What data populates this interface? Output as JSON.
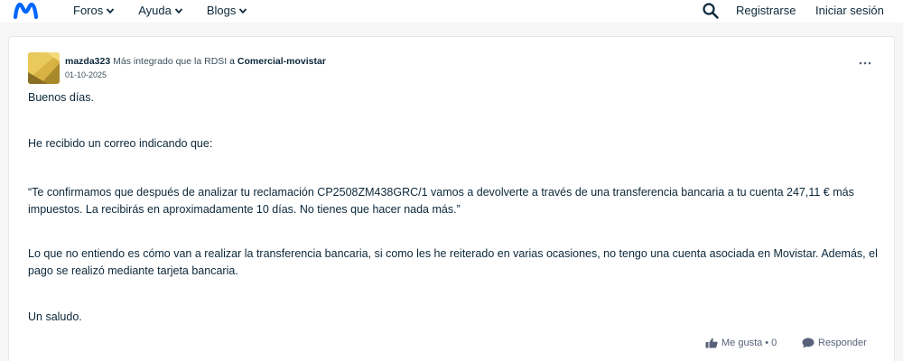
{
  "header": {
    "nav": [
      {
        "label": "Foros"
      },
      {
        "label": "Ayuda"
      },
      {
        "label": "Blogs"
      }
    ],
    "register_label": "Registrarse",
    "login_label": "Iniciar sesión"
  },
  "post": {
    "author": "mazda323",
    "author_role": "Más integrado que la RDSI",
    "board_prefix": "a",
    "board": "Comercial-movistar",
    "date": "01-10-2025",
    "paragraphs": [
      "Buenos días.",
      "He recibido un correo indicando que:",
      "“Te confirmamos que después de analizar tu reclamación CP2508ZM438GRC/1 vamos a devolverte a través de una transferencia bancaria a tu cuenta 247,11 € más impuestos. La recibirás en aproximadamente 10 días. No tienes que hacer nada más.”",
      "Lo que no entiendo es cómo van a realizar la transferencia bancaria, si como les he reiterado en varias ocasiones, no tengo una cuenta asociada en Movistar. Además, el pago se realizó mediante tarjeta bancaria.",
      "Un saludo."
    ],
    "like_label": "Me gusta",
    "like_count": "0",
    "reply_label": "Responder"
  },
  "colors": {
    "brand": "#0066ff",
    "text": "#0b2739",
    "muted": "#58617a"
  }
}
